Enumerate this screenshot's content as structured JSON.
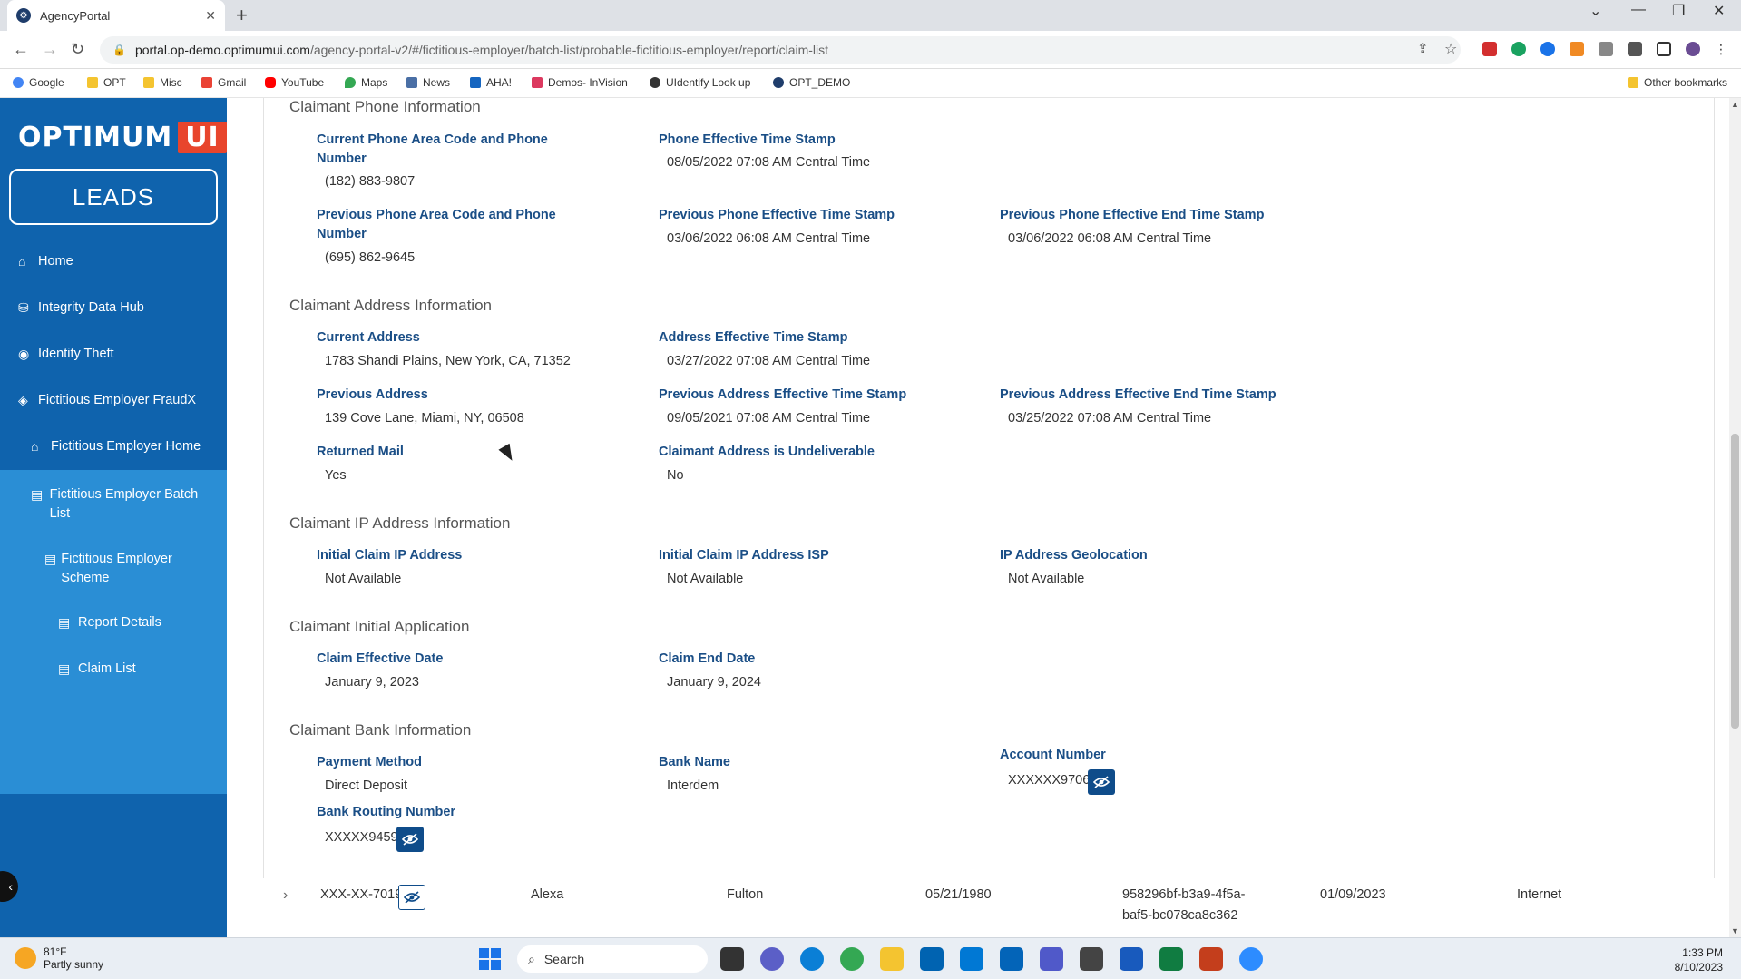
{
  "browser": {
    "tab_title": "AgencyPortal",
    "url_host": "portal.op-demo.optimumui.com",
    "url_path": "/agency-portal-v2/#/fictitious-employer/batch-list/probable-fictitious-employer/report/claim-list",
    "bookmarks": [
      "Google",
      "OPT",
      "Misc",
      "Gmail",
      "YouTube",
      "Maps",
      "News",
      "AHA!",
      "Demos- InVision",
      "UIdentify Look up",
      "OPT_DEMO"
    ],
    "other_bookmarks": "Other bookmarks"
  },
  "sidebar": {
    "logo_text": "OPTIMUM",
    "logo_ui": "UI",
    "leads_label": "LEADS",
    "items": [
      {
        "label": "Home"
      },
      {
        "label": "Integrity Data Hub"
      },
      {
        "label": "Identity Theft"
      },
      {
        "label": "Fictitious Employer FraudX"
      },
      {
        "label": "Fictitious Employer Home"
      },
      {
        "label": "Fictitious Employer Batch List"
      },
      {
        "label": "Fictitious Employer Scheme"
      },
      {
        "label": "Report Details"
      },
      {
        "label": "Claim List"
      }
    ]
  },
  "phone": {
    "title": "Claimant Phone Information",
    "current_label": "Current Phone Area Code and Phone Number",
    "current_value": "(182) 883-9807",
    "effective_label": "Phone Effective Time Stamp",
    "effective_value": "08/05/2022 07:08 AM Central Time",
    "previous_label": "Previous Phone Area Code and Phone Number",
    "previous_value": "(695) 862-9645",
    "prev_effective_label": "Previous Phone Effective Time Stamp",
    "prev_effective_value": "03/06/2022 06:08 AM Central Time",
    "prev_end_label": "Previous Phone Effective End Time Stamp",
    "prev_end_value": "03/06/2022 06:08 AM Central Time"
  },
  "address": {
    "title": "Claimant Address Information",
    "current_label": "Current Address",
    "current_value": "1783 Shandi Plains, New York, CA, 71352",
    "effective_label": "Address Effective Time Stamp",
    "effective_value": "03/27/2022 07:08 AM Central Time",
    "previous_label": "Previous Address",
    "previous_value": "139 Cove Lane, Miami, NY, 06508",
    "prev_effective_label": "Previous Address Effective Time Stamp",
    "prev_effective_value": "09/05/2021 07:08 AM Central Time",
    "prev_end_label": "Previous Address Effective End Time Stamp",
    "prev_end_value": "03/25/2022 07:08 AM Central Time",
    "returned_label": "Returned Mail",
    "returned_value": "Yes",
    "undeliverable_label": "Claimant Address is Undeliverable",
    "undeliverable_value": "No"
  },
  "ip": {
    "title": "Claimant IP Address Information",
    "initial_label": "Initial Claim IP Address",
    "initial_value": "Not Available",
    "isp_label": "Initial Claim IP Address ISP",
    "isp_value": "Not Available",
    "geo_label": "IP Address Geolocation",
    "geo_value": "Not Available"
  },
  "application": {
    "title": "Claimant Initial Application",
    "effective_label": "Claim Effective Date",
    "effective_value": "January 9, 2023",
    "end_label": "Claim End Date",
    "end_value": "January 9, 2024"
  },
  "bank": {
    "title": "Claimant Bank Information",
    "payment_label": "Payment Method",
    "payment_value": "Direct Deposit",
    "bank_label": "Bank Name",
    "bank_value": "Interdem",
    "account_label": "Account Number",
    "account_value": "XXXXXX9706",
    "routing_label": "Bank Routing Number",
    "routing_value": "XXXXX9459"
  },
  "next_row": {
    "ssn": "XXX-XX-7019",
    "first_name": "Alexa",
    "last_name": "Fulton",
    "dob": "05/21/1980",
    "claim_id_line1": "958296bf-b3a9-4f5a-",
    "claim_id_line2": "baf5-bc078ca8c362",
    "filed_date": "01/09/2023",
    "channel": "Internet"
  },
  "taskbar": {
    "temp": "81°F",
    "weather": "Partly sunny",
    "search_placeholder": "Search",
    "time": "1:33 PM",
    "date": "8/10/2023"
  }
}
